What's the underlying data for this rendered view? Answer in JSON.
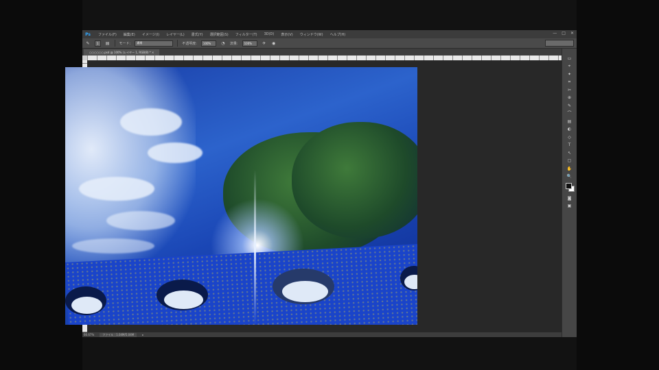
{
  "app": {
    "logo": "Ps",
    "menu": [
      "ファイル(F)",
      "編集(E)",
      "イメージ(I)",
      "レイヤー(L)",
      "書式(Y)",
      "選択範囲(S)",
      "フィルター(T)",
      "3D(D)",
      "表示(V)",
      "ウィンドウ(W)",
      "ヘルプ(H)"
    ],
    "window_controls": [
      "—",
      "□",
      "✕"
    ]
  },
  "options": {
    "tool_icon": "brush-icon",
    "size_value": "1",
    "mode_label": "モード:",
    "mode_value": "通常",
    "opacity_label": "不透明度:",
    "opacity_value": "100%",
    "flow_label": "流量:",
    "flow_value": "100%"
  },
  "document": {
    "tab_title": "○○○○○○.psd @ 100% (レイヤー 1, RGB/8) * ×",
    "zoom": "66.67%",
    "doc_info": "ファイル : 1.04M/5.04M"
  },
  "toolbar": {
    "tools": [
      "▭",
      "⌖",
      "✦",
      "⌗",
      "✂",
      "⊕",
      "✎",
      "⌒",
      "▤",
      "◐",
      "◇",
      "T",
      "↖",
      "▢",
      "✋",
      "🔍"
    ]
  },
  "colors": {
    "app_bg": "#535353",
    "menubar": "#3c3c3c",
    "canvas_bg": "#282828",
    "accent": "#31a8ff"
  }
}
